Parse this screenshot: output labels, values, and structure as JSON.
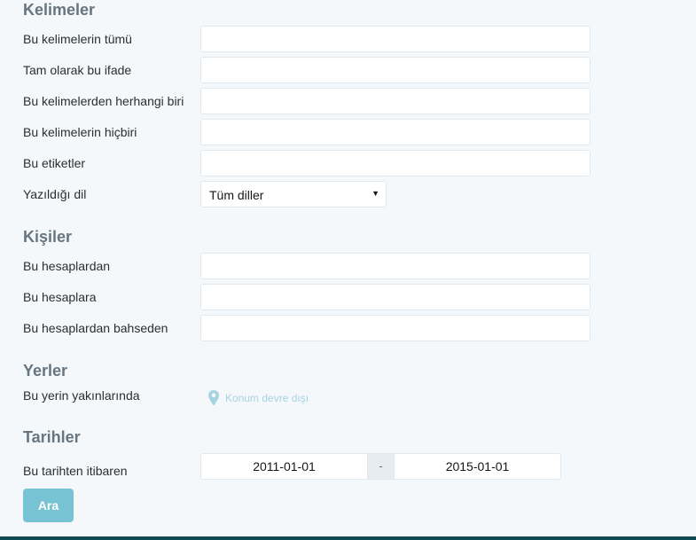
{
  "words": {
    "title": "Kelimeler",
    "all_words_label": "Bu kelimelerin tümü",
    "all_words_value": "",
    "exact_phrase_label": "Tam olarak bu ifade",
    "exact_phrase_value": "",
    "any_words_label": "Bu kelimelerden herhangi biri",
    "any_words_value": "",
    "none_words_label": "Bu kelimelerin hiçbiri",
    "none_words_value": "",
    "hashtags_label": "Bu etiketler",
    "hashtags_value": "",
    "language_label": "Yazıldığı dil",
    "language_selected": "Tüm diller",
    "language_arrow_icon": "caret-down-icon"
  },
  "people": {
    "title": "Kişiler",
    "from_label": "Bu hesaplardan",
    "from_value": "",
    "to_label": "Bu hesaplara",
    "to_value": "",
    "mentioning_label": "Bu hesaplardan bahseden",
    "mentioning_value": ""
  },
  "places": {
    "title": "Yerler",
    "near_label": "Bu yerin yakınlarında",
    "location_text": "Konum devre dışı",
    "location_icon": "map-pin-icon"
  },
  "dates": {
    "title": "Tarihler",
    "since_label": "Bu tarihten itibaren",
    "from_date": "2011-01-01",
    "separator": "-",
    "to_date": "2015-01-01"
  },
  "search_button_label": "Ara",
  "colors": {
    "background": "#f5f8fa",
    "section_title": "#66757f",
    "button": "#78c3d3",
    "location_text": "#a6d4e0",
    "footer": "#0e4a52"
  }
}
